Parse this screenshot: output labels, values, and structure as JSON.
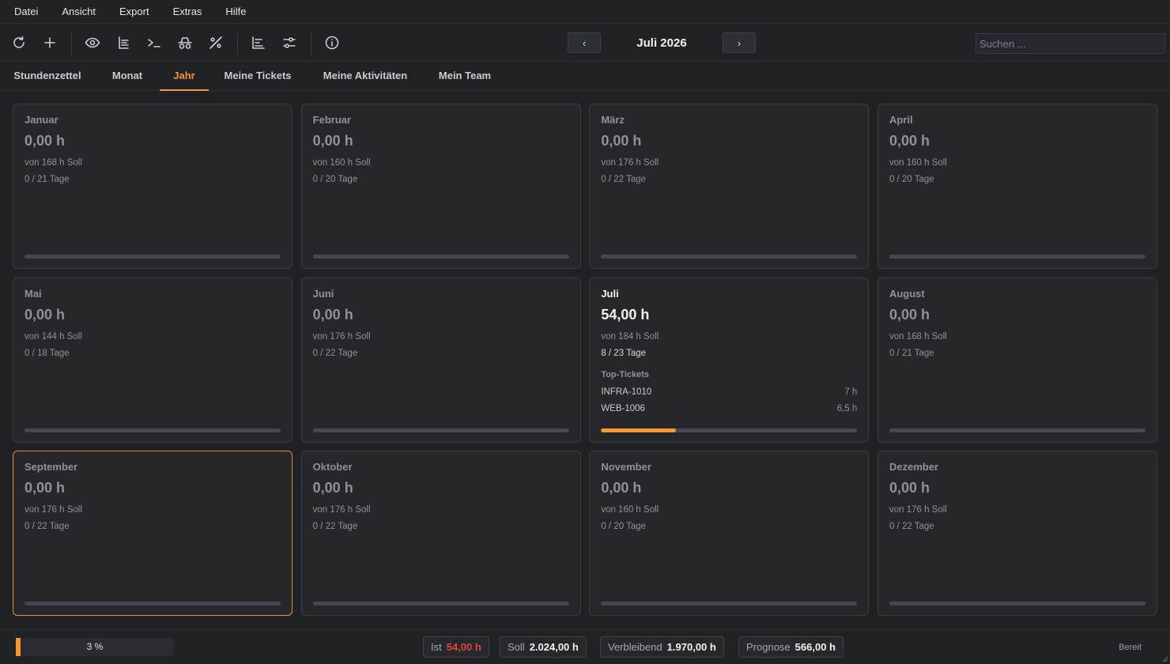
{
  "menu": [
    "Datei",
    "Ansicht",
    "Export",
    "Extras",
    "Hilfe"
  ],
  "toolbar": {
    "icons": [
      "refresh-icon",
      "plus-icon",
      "eye-icon",
      "list-icon",
      "terminal-icon",
      "incognito-icon",
      "percent-off-icon",
      "gantt-icon",
      "sliders-icon",
      "info-icon"
    ],
    "prev_label": "‹",
    "next_label": "›",
    "period": "Juli 2026",
    "search_placeholder": "Suchen ..."
  },
  "tabs": [
    {
      "label": "Stundenzettel",
      "active": false
    },
    {
      "label": "Monat",
      "active": false
    },
    {
      "label": "Jahr",
      "active": true
    },
    {
      "label": "Meine Tickets",
      "active": false
    },
    {
      "label": "Meine Aktivitäten",
      "active": false
    },
    {
      "label": "Mein Team",
      "active": false
    }
  ],
  "months": [
    {
      "name": "Januar",
      "hours": "0,00 h",
      "soll": "von 168 h Soll",
      "days": "0 / 21 Tage",
      "progress": 0
    },
    {
      "name": "Februar",
      "hours": "0,00 h",
      "soll": "von 160 h Soll",
      "days": "0 / 20 Tage",
      "progress": 0
    },
    {
      "name": "März",
      "hours": "0,00 h",
      "soll": "von 176 h Soll",
      "days": "0 / 22 Tage",
      "progress": 0
    },
    {
      "name": "April",
      "hours": "0,00 h",
      "soll": "von 160 h Soll",
      "days": "0 / 20 Tage",
      "progress": 0
    },
    {
      "name": "Mai",
      "hours": "0,00 h",
      "soll": "von 144 h Soll",
      "days": "0 / 18 Tage",
      "progress": 0
    },
    {
      "name": "Juni",
      "hours": "0,00 h",
      "soll": "von 176 h Soll",
      "days": "0 / 22 Tage",
      "progress": 0
    },
    {
      "name": "Juli",
      "hours": "54,00 h",
      "soll": "von 184 h Soll",
      "days": "8 / 23 Tage",
      "progress": 0.293,
      "current": true,
      "top_label": "Top-Tickets",
      "tickets": [
        {
          "id": "INFRA-1010",
          "hours": "7 h"
        },
        {
          "id": "WEB-1006",
          "hours": "6,5 h"
        }
      ]
    },
    {
      "name": "August",
      "hours": "0,00 h",
      "soll": "von 168 h Soll",
      "days": "0 / 21 Tage",
      "progress": 0
    },
    {
      "name": "September",
      "hours": "0,00 h",
      "soll": "von 176 h Soll",
      "days": "0 / 22 Tage",
      "progress": 0,
      "selected": true
    },
    {
      "name": "Oktober",
      "hours": "0,00 h",
      "soll": "von 176 h Soll",
      "days": "0 / 22 Tage",
      "progress": 0
    },
    {
      "name": "November",
      "hours": "0,00 h",
      "soll": "von 160 h Soll",
      "days": "0 / 20 Tage",
      "progress": 0
    },
    {
      "name": "Dezember",
      "hours": "0,00 h",
      "soll": "von 176 h Soll",
      "days": "0 / 22 Tage",
      "progress": 0
    }
  ],
  "status": {
    "overall_progress": 0.03,
    "overall_label": "3 %",
    "ist_label": "Ist",
    "ist_value": "54,00 h",
    "soll_label": "Soll",
    "soll_value": "2.024,00 h",
    "remaining_label": "Verbleibend",
    "remaining_value": "1.970,00 h",
    "forecast_label": "Prognose",
    "forecast_value": "566,00 h",
    "state": "Bereit"
  },
  "colors": {
    "accent": "#f5962f",
    "negative": "#e5433a"
  }
}
